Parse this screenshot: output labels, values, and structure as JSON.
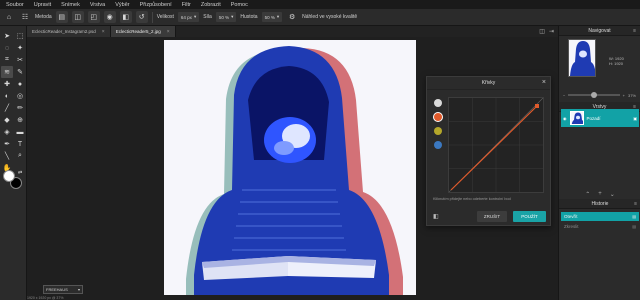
{
  "menu": [
    "Soubor",
    "Upravit",
    "Snímek",
    "Vrstva",
    "Výběr",
    "Přizpůsobení",
    "Filtr",
    "Zobrazit",
    "Pomoc"
  ],
  "options": {
    "tool_label": "Metoda",
    "brush_label": "Velikost",
    "brush_value": "64 px",
    "shape_label": "Síla",
    "shape_value": "50 %",
    "hardness_label": "Hustota",
    "hardness_value": "50 %",
    "sample_label": "Náhled ve vysoké kvalitě"
  },
  "tabs": [
    {
      "label": "EclecticReader_Instagram2.psd",
      "active": false
    },
    {
      "label": "EclecticReader5_2.jpg",
      "active": true
    }
  ],
  "canvas": {
    "zoom": "FREEHAUS",
    "status": "1920 x 1920 px @ 37%"
  },
  "curves": {
    "title": "Křivky",
    "hint": "Kliknutím přidejte nebo odeberte kontrolní bod",
    "reset_label": "ZRUŠIT",
    "apply_label": "POUŽÍT",
    "channels": [
      "white",
      "red",
      "yellow",
      "blue"
    ]
  },
  "navigator": {
    "title": "Navigovat",
    "width": "W: 1920",
    "height": "H: 1920",
    "zoom": "37%"
  },
  "layers": {
    "title": "Vrstvy",
    "items": [
      {
        "name": "Pozadí"
      }
    ]
  },
  "history": {
    "title": "Historie",
    "items": [
      {
        "label": "Otevřít",
        "active": true
      },
      {
        "label": "Zkreslit",
        "active": false
      }
    ]
  },
  "colors": {
    "accent": "#12a2a6",
    "foreground": "#ffffff",
    "background": "#000000",
    "curve_line": "#e05a2b"
  }
}
